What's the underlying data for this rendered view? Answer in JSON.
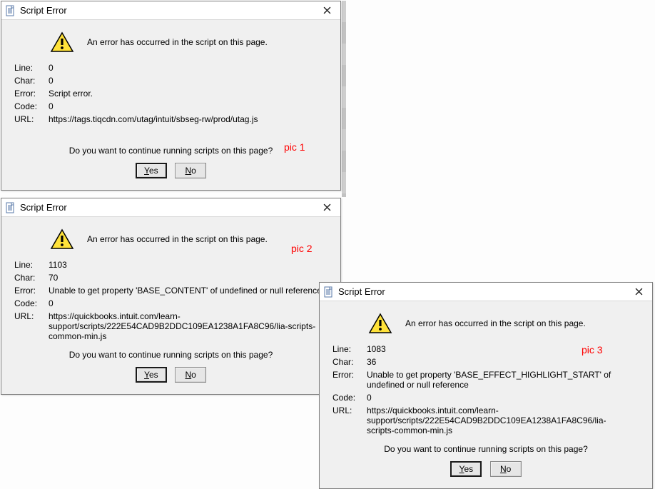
{
  "dialogs": [
    {
      "title": "Script Error",
      "message": "An error has occurred in the script on this page.",
      "labels": {
        "line": "Line:",
        "char": "Char:",
        "error": "Error:",
        "code": "Code:",
        "url": "URL:"
      },
      "values": {
        "line": "0",
        "char": "0",
        "error": "Script error.",
        "code": "0",
        "url": "https://tags.tiqcdn.com/utag/intuit/sbseg-rw/prod/utag.js"
      },
      "continue_prompt": "Do you want to continue running scripts on this page?",
      "buttons": {
        "yes": "Yes",
        "no": "No"
      },
      "pic_label": "pic 1"
    },
    {
      "title": "Script Error",
      "message": "An error has occurred in the script on this page.",
      "labels": {
        "line": "Line:",
        "char": "Char:",
        "error": "Error:",
        "code": "Code:",
        "url": "URL:"
      },
      "values": {
        "line": "1103",
        "char": "70",
        "error": "Unable to get property 'BASE_CONTENT' of undefined or null reference",
        "code": "0",
        "url": "https://quickbooks.intuit.com/learn-support/scripts/222E54CAD9B2DDC109EA1238A1FA8C96/lia-scripts-common-min.js"
      },
      "continue_prompt": "Do you want to continue running scripts on this page?",
      "buttons": {
        "yes": "Yes",
        "no": "No"
      },
      "pic_label": "pic 2"
    },
    {
      "title": "Script Error",
      "message": "An error has occurred in the script on this page.",
      "labels": {
        "line": "Line:",
        "char": "Char:",
        "error": "Error:",
        "code": "Code:",
        "url": "URL:"
      },
      "values": {
        "line": "1083",
        "char": "36",
        "error": "Unable to get property 'BASE_EFFECT_HIGHLIGHT_START' of undefined or null reference",
        "code": "0",
        "url": "https://quickbooks.intuit.com/learn-support/scripts/222E54CAD9B2DDC109EA1238A1FA8C96/lia-scripts-common-min.js"
      },
      "continue_prompt": "Do you want to continue running scripts on this page?",
      "buttons": {
        "yes": "Yes",
        "no": "No"
      },
      "pic_label": "pic 3"
    }
  ]
}
